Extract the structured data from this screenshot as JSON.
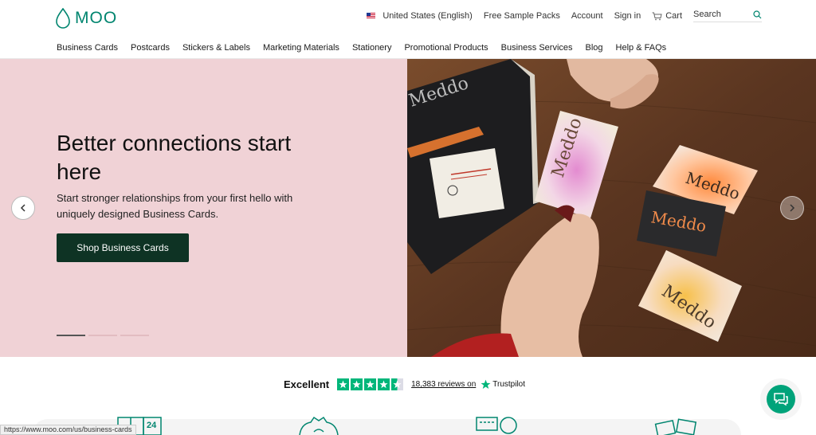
{
  "brand": {
    "name": "MOO",
    "color": "#00856f"
  },
  "utility": {
    "locale": "United States (English)",
    "sample_packs": "Free Sample Packs",
    "account": "Account",
    "sign_in": "Sign in",
    "cart": "Cart",
    "search_placeholder": "Search"
  },
  "nav": {
    "items": [
      "Business Cards",
      "Postcards",
      "Stickers & Labels",
      "Marketing Materials",
      "Stationery",
      "Promotional Products",
      "Business Services",
      "Blog",
      "Help & FAQs"
    ]
  },
  "hero": {
    "title": "Better connections start here",
    "subtitle": "Start stronger relationships from your first hello with uniquely designed Business Cards.",
    "cta": "Shop Business Cards",
    "background": "#f0d2d6",
    "cta_color": "#0e3324",
    "slides_total": 3,
    "slide_active": 1,
    "card_brand": "Meddo"
  },
  "trustpilot": {
    "rating_label": "Excellent",
    "reviews_text": "18,383 reviews on",
    "brand": "Trustpilot",
    "star_color": "#00b67a"
  },
  "status_url": "https://www.moo.com/us/business-cards"
}
